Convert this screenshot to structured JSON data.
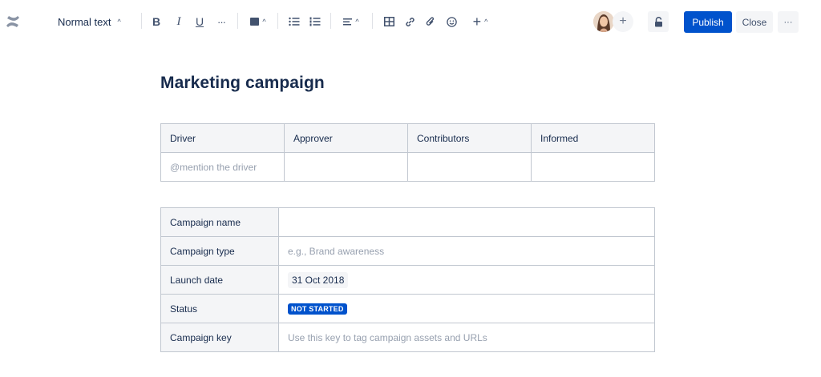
{
  "toolbar": {
    "logo_icon": "confluence-logo-icon",
    "text_style": "Normal text",
    "icons": {
      "caret": "^",
      "bold": "B",
      "italic": "I",
      "underline": "U",
      "more": "···",
      "insert": "+"
    },
    "accent_color": "#0052cc"
  },
  "actions": {
    "publish_label": "Publish",
    "close_label": "Close",
    "more_label": "···",
    "add_collaborator": "+"
  },
  "page": {
    "title": "Marketing campaign",
    "roles_table": {
      "headers": [
        "Driver",
        "Approver",
        "Contributors",
        "Informed"
      ],
      "row": [
        "@mention the driver",
        "",
        "",
        ""
      ]
    },
    "details_table": {
      "rows": [
        {
          "label": "Campaign name",
          "value": ""
        },
        {
          "label": "Campaign type",
          "value": "e.g., Brand awareness"
        },
        {
          "label": "Launch date",
          "value": "31 Oct 2018"
        },
        {
          "label": "Status",
          "value": "NOT STARTED"
        },
        {
          "label": "Campaign key",
          "value": "Use this key to tag campaign assets and URLs"
        }
      ]
    }
  }
}
